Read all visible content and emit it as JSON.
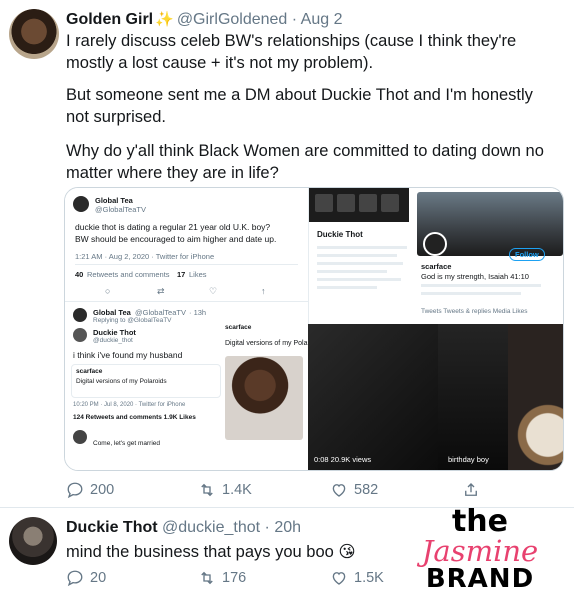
{
  "tweet1": {
    "name": "Golden Girl",
    "badge_icon": "sparkle-icon",
    "handle": "@GirlGoldened",
    "separator": "·",
    "time": "Aug 2",
    "line1": "I rarely discuss celeb BW's relationships (cause I think they're mostly a lost cause + it's not my problem).",
    "line2": "But someone sent me a DM about Duckie Thot and I'm honestly not surprised.",
    "line3": "Why do y'all think Black Women are committed to dating down no matter where they are in life?",
    "replies": "200",
    "retweets": "1.4K",
    "likes": "582"
  },
  "embed": {
    "a_name": "Global Tea",
    "a_handle": "@GlobalTeaTV",
    "a_text1": "duckie thot is dating a regular 21 year old U.K. boy?",
    "a_text2": "BW should be encouraged to aim higher and date up.",
    "a_meta": "1:21 AM · Aug 2, 2020 · Twitter for iPhone",
    "a_rt": "40",
    "a_rt_label": "Retweets and comments",
    "a_likes": "17",
    "a_likes_label": "Likes",
    "c_name": "Global Tea",
    "c_handle": "@GlobalTeaTV",
    "c_time": "· 13h",
    "c_reply": "Replying to @GlobalTeaTV",
    "c_inner_name": "Duckie Thot",
    "c_inner_handle": "@duckie_thot",
    "c_inner_text": "i think i've found my husband",
    "c_quote_name": "scarface",
    "c_quote_text": "Digital versions of my Polaroids",
    "c_meta": "10:20 PM · Jul 8, 2020 · Twitter for iPhone",
    "c_stats": "124 Retweets and comments   1.9K Likes",
    "c_reply2": "Come, let's get married",
    "b_profile_name": "Duckie Thot",
    "b_scarface": "scarface",
    "b_scar_bio": "God is my strength, Isaiah 41:10",
    "b_follow": "Follow",
    "b_tabs": "Tweets   Tweets & replies   Media   Likes",
    "d_time": "0:08   20.9K views",
    "d_caption": "birthday boy"
  },
  "tweet2": {
    "name": "Duckie Thot",
    "handle": "@duckie_thot",
    "separator": "·",
    "time": "20h",
    "text": "mind the business that pays you boo 😘",
    "replies": "20",
    "retweets": "176",
    "likes": "1.5K"
  },
  "watermark": {
    "the": "the",
    "jasmine": "Jasmine",
    "brand": "BRAND"
  },
  "colors": {
    "text": "#14171a",
    "muted": "#657786",
    "accent": "#1da1f2",
    "brand_pink": "#e8416f"
  }
}
